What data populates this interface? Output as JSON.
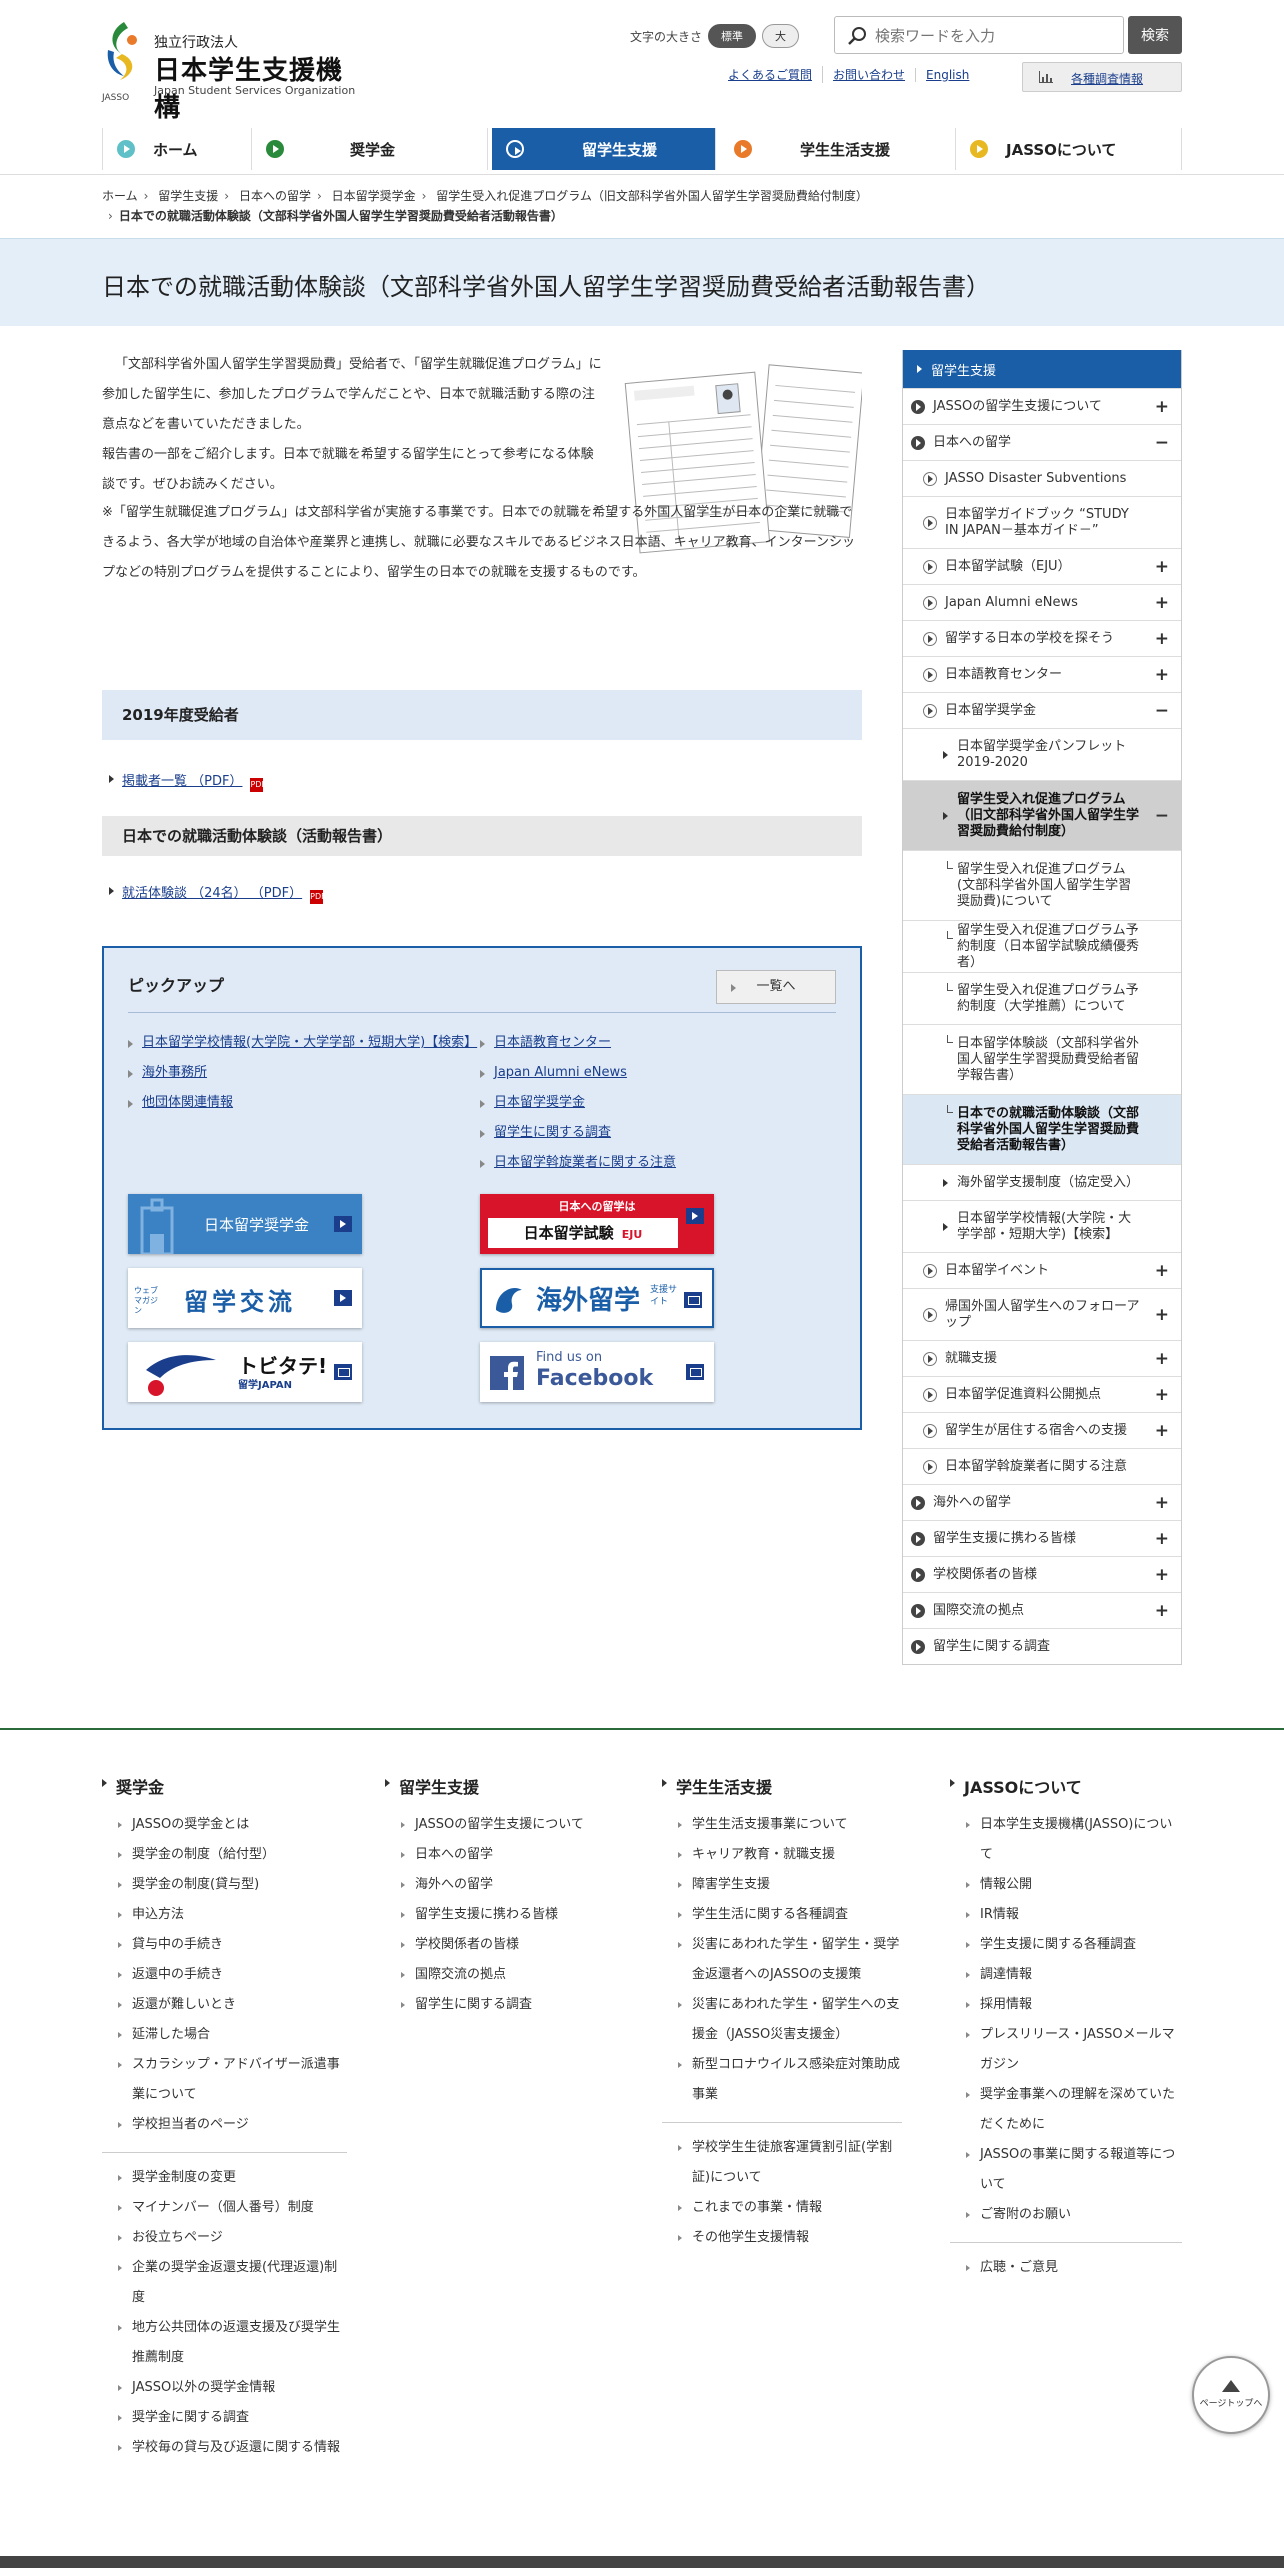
{
  "header": {
    "logo_small": "独立行政法人",
    "logo_main": "日本学生支援機構",
    "logo_en": "Japan Student Services Organization",
    "logo_jasso": "JASSO",
    "fontsize_label": "文字の大きさ",
    "fontsize_standard": "標準",
    "fontsize_large": "大",
    "search_placeholder": "検索ワードを入力",
    "search_button": "検索",
    "utils": [
      "よくあるご質問",
      "お問い合わせ",
      "English"
    ],
    "survey_button": "各種調査情報"
  },
  "gnav": [
    {
      "label": "ホーム",
      "color": "#5fc0c8"
    },
    {
      "label": "奨学金",
      "color": "#2a8a3c"
    },
    {
      "label": "留学生支援",
      "color": "#1a5ea8"
    },
    {
      "label": "学生生活支援",
      "color": "#e87a2a"
    },
    {
      "label": "JASSOについて",
      "color": "#e8b820"
    }
  ],
  "breadcrumb": [
    "ホーム",
    "留学生支援",
    "日本への留学",
    "日本留学奨学金",
    "留学生受入れ促進プログラム（旧文部科学省外国人留学生学習奨励費給付制度）",
    "日本での就職活動体験談（文部科学省外国人留学生学習奨励費受給者活動報告書）"
  ],
  "page_title": "日本での就職活動体験談（文部科学省外国人留学生学習奨励費受給者活動報告書）",
  "intro": {
    "p1": "「文部科学省外国人留学生学習奨励費」受給者で、「留学生就職促進プログラム」に参加した留学生に、参加したプログラムで学んだことや、日本で就職活動する際の注意点などを書いていただきました。",
    "p2": "報告書の一部をご紹介します。日本で就職を希望する留学生にとって参考になる体験談です。ぜひお読みください。",
    "p3": "※「留学生就職促進プログラム」は文部科学省が実施する事業です。日本での就職を希望する外国人留学生が日本の企業に就職できるよう、各大学が地域の自治体や産業界と連携し、就職に必要なスキルであるビジネス日本語、キャリア教育、インターンシップなどの特別プログラムを提供することにより、留学生の日本での就職を支援するものです。"
  },
  "sections": [
    {
      "heading": "2019年度受給者",
      "link": "掲載者一覧 （PDF）"
    },
    {
      "heading": "日本での就職活動体験談（活動報告書）",
      "link": "就活体験談 （24名） （PDF）"
    }
  ],
  "pdf_label": "PDF",
  "pickup": {
    "title": "ピックアップ",
    "more": "一覧へ",
    "left_links": [
      "日本留学学校情報(大学院・大学学部・短期大学)【検索】",
      "海外事務所",
      "他団体関連情報"
    ],
    "right_links": [
      "日本語教育センター",
      "Japan Alumni eNews",
      "日本留学奨学金",
      "留学生に関する調査",
      "日本留学斡旋業者に関する注意"
    ],
    "banners": {
      "scholarship": "日本留学奨学金",
      "eju_top": "日本への留学は",
      "eju_main": "日本留学試験",
      "eju_tag": "EJU",
      "webmag_small": "ウェブマガジン",
      "webmag_main": "留学交流",
      "kaigai_main": "海外留学",
      "kaigai_sub": "支援サイト",
      "tobitate_main": "トビタテ!",
      "tobitate_sub": "留学JAPAN",
      "fb_find": "Find us on",
      "fb_main": "Facebook"
    }
  },
  "side": {
    "top": "留学生支援",
    "items": [
      {
        "label": "JASSOの留学生支援について",
        "lv": 0,
        "pm": "+"
      },
      {
        "label": "日本への留学",
        "lv": 0,
        "pm": "−"
      },
      {
        "label": "JASSO Disaster Subventions",
        "lv": 1,
        "pm": ""
      },
      {
        "label": "日本留学ガイドブック “STUDY IN JAPAN－基本ガイド－”",
        "lv": 1,
        "pm": ""
      },
      {
        "label": "日本留学試験（EJU）",
        "lv": 1,
        "pm": "+"
      },
      {
        "label": "Japan Alumni eNews",
        "lv": 1,
        "pm": "+"
      },
      {
        "label": "留学する日本の学校を探そう",
        "lv": 1,
        "pm": "+"
      },
      {
        "label": "日本語教育センター",
        "lv": 1,
        "pm": "+"
      },
      {
        "label": "日本留学奨学金",
        "lv": 1,
        "pm": "−"
      },
      {
        "label": "日本留学奨学金パンフレット2019-2020",
        "lv": 2,
        "pm": ""
      },
      {
        "label": "留学生受入れ促進プログラム（旧文部科学省外国人留学生学習奨励費給付制度）",
        "lv": 2,
        "pm": "−",
        "hl": true
      },
      {
        "label": "留学生受入れ促進プログラム(文部科学省外国人留学生学習奨励費)について",
        "lv": 3,
        "pm": ""
      },
      {
        "label": "留学生受入れ促進プログラム予約制度（日本留学試験成績優秀者）",
        "lv": 3,
        "pm": ""
      },
      {
        "label": "留学生受入れ促進プログラム予約制度（大学推薦）について",
        "lv": 3,
        "pm": ""
      },
      {
        "label": "日本留学体験談（文部科学省外国人留学生学習奨励費受給者留学報告書）",
        "lv": 3,
        "pm": ""
      },
      {
        "label": "日本での就職活動体験談（文部科学省外国人留学生学習奨励費受給者活動報告書）",
        "lv": 3,
        "pm": "",
        "cur": true
      },
      {
        "label": "海外留学支援制度（協定受入）",
        "lv": 2,
        "pm": ""
      },
      {
        "label": "日本留学学校情報(大学院・大学学部・短期大学)【検索】",
        "lv": 2,
        "pm": ""
      },
      {
        "label": "日本留学イベント",
        "lv": 1,
        "pm": "+"
      },
      {
        "label": "帰国外国人留学生へのフォローアップ",
        "lv": 1,
        "pm": "+"
      },
      {
        "label": "就職支援",
        "lv": 1,
        "pm": "+"
      },
      {
        "label": "日本留学促進資料公開拠点",
        "lv": 1,
        "pm": "+"
      },
      {
        "label": "留学生が居住する宿舎への支援",
        "lv": 1,
        "pm": "+"
      },
      {
        "label": "日本留学斡旋業者に関する注意",
        "lv": 1,
        "pm": ""
      },
      {
        "label": "海外への留学",
        "lv": 0,
        "pm": "+"
      },
      {
        "label": "留学生支援に携わる皆様",
        "lv": 0,
        "pm": "+"
      },
      {
        "label": "学校関係者の皆様",
        "lv": 0,
        "pm": "+"
      },
      {
        "label": "国際交流の拠点",
        "lv": 0,
        "pm": "+"
      },
      {
        "label": "留学生に関する調査",
        "lv": 0,
        "pm": ""
      }
    ]
  },
  "footer": {
    "cols": [
      {
        "title": "奨学金",
        "a": [
          "JASSOの奨学金とは",
          "奨学金の制度（給付型）",
          "奨学金の制度(貸与型)",
          "申込方法",
          "貸与中の手続き",
          "返還中の手続き",
          "返還が難しいとき",
          "延滞した場合",
          "スカラシップ・アドバイザー派遣事業について",
          "学校担当者のページ"
        ],
        "b": [
          "奨学金制度の変更",
          "マイナンバー（個人番号）制度",
          "お役立ちページ",
          "企業の奨学金返還支援(代理返還)制度",
          "地方公共団体の返還支援及び奨学生推薦制度",
          "JASSO以外の奨学金情報",
          "奨学金に関する調査",
          "学校毎の貸与及び返還に関する情報"
        ]
      },
      {
        "title": "留学生支援",
        "a": [
          "JASSOの留学生支援について",
          "日本への留学",
          "海外への留学",
          "留学生支援に携わる皆様",
          "学校関係者の皆様",
          "国際交流の拠点",
          "留学生に関する調査"
        ],
        "b": []
      },
      {
        "title": "学生生活支援",
        "a": [
          "学生生活支援事業について",
          "キャリア教育・就職支援",
          "障害学生支援",
          "学生生活に関する各種調査",
          "災害にあわれた学生・留学生・奨学金返還者へのJASSOの支援策",
          "災害にあわれた学生・留学生への支援金（JASSO災害支援金）",
          "新型コロナウイルス感染症対策助成事業"
        ],
        "b": [
          "学校学生生徒旅客運賃割引証(学割証)について",
          "これまでの事業・情報",
          "その他学生支援情報"
        ]
      },
      {
        "title": "JASSOについて",
        "a": [
          "日本学生支援機構(JASSO)について",
          "情報公開",
          "IR情報",
          "学生支援に関する各種調査",
          "調達情報",
          "採用情報",
          "プレスリリース・JASSOメールマガジン",
          "奨学金事業への理解を深めていただくために",
          "JASSOの事業に関する報道等について",
          "ご寄附のお願い"
        ],
        "b": [
          "広聴・ご意見"
        ]
      }
    ],
    "pagetop": "ページトップへ"
  }
}
